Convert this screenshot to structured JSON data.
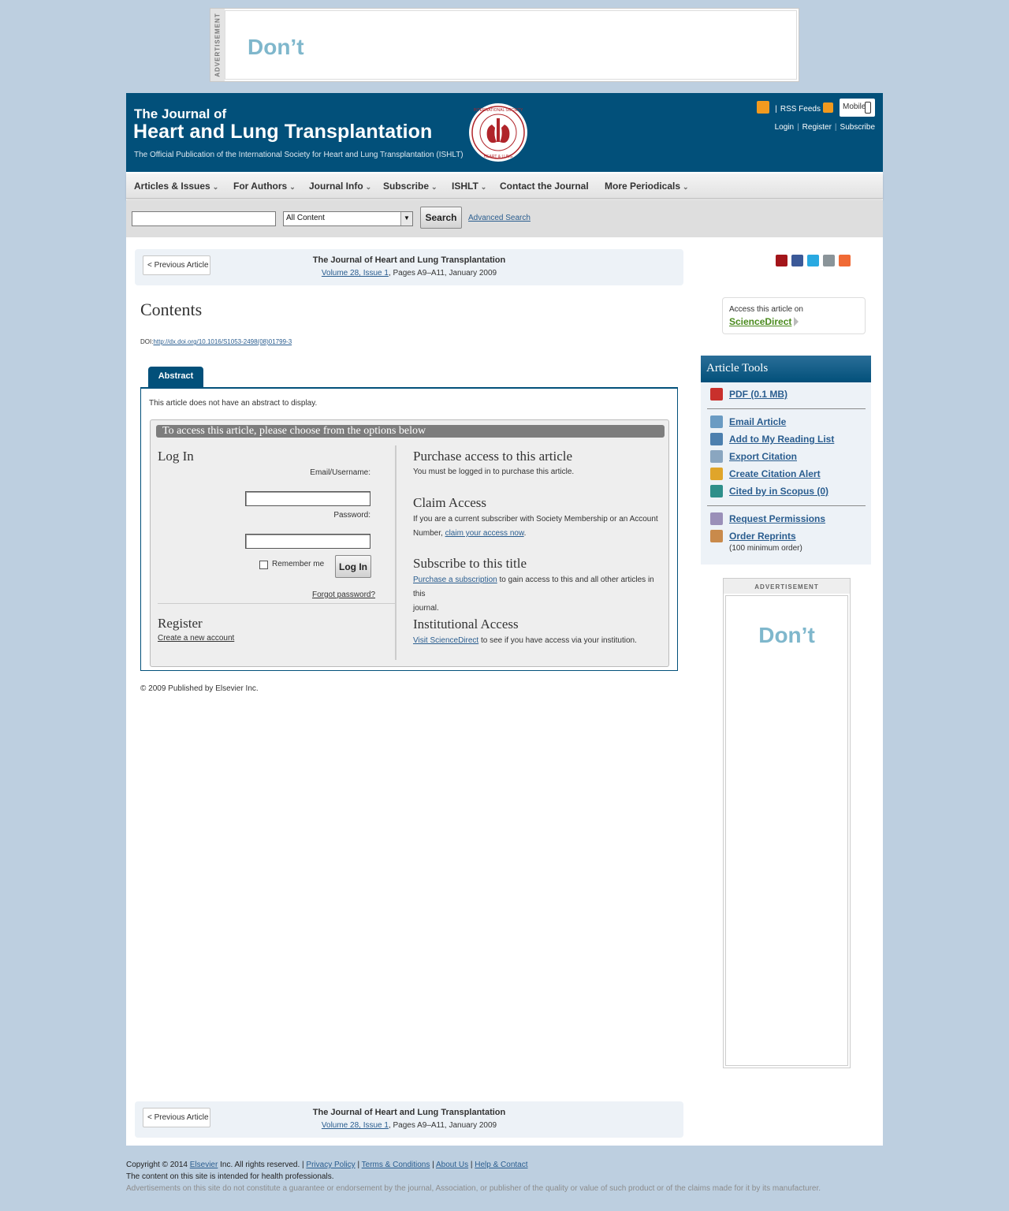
{
  "top_ad": {
    "label": "ADVERTISEMENT",
    "text": "Don’t"
  },
  "masthead": {
    "title_line1": "The Journal of",
    "title_line2": "Heart and Lung Transplantation",
    "subtitle": "The Official Publication of the International Society for Heart and Lung Transplantation (ISHLT)",
    "seal_label": "International Society for Heart & Lung Transplantation",
    "rss_feeds": "RSS Feeds",
    "mobile": "Mobile",
    "login": "Login",
    "register": "Register",
    "subscribe": "Subscribe"
  },
  "nav": {
    "articles_issues": "Articles & Issues",
    "for_authors": "For Authors",
    "journal_info": "Journal Info",
    "subscribe": "Subscribe",
    "ishlt": "ISHLT",
    "contact": "Contact the Journal",
    "more_periodicals": "More Periodicals"
  },
  "search": {
    "query": "",
    "scope": "All Content",
    "button": "Search",
    "advanced": "Advanced Search"
  },
  "article_nav": {
    "previous": "< Previous Article",
    "journal": "The Journal of Heart and Lung Transplantation",
    "volume_link": "Volume 28, Issue 1",
    "pages": ", Pages A9–A11, January 2009"
  },
  "article": {
    "title": "Contents",
    "doi_label": "DOI:",
    "doi_link": "http://dx.doi.org/10.1016/S1053-2498(08)01799-3",
    "tab_abstract": "Abstract",
    "no_abstract": "This article does not have an abstract to display.",
    "access_heading": "To access this article, please choose from the options below",
    "copyright": "© 2009 Published by Elsevier Inc."
  },
  "login": {
    "heading": "Log In",
    "email_label": "Email/Username:",
    "email_value": "",
    "password_label": "Password:",
    "password_value": "",
    "remember": "Remember me",
    "button": "Log In",
    "forgot": "Forgot password?",
    "register_heading": "Register",
    "create_account": "Create a new account"
  },
  "options": {
    "purchase_heading": "Purchase access to this article",
    "purchase_text": "You must be logged in to purchase this article.",
    "claim_heading": "Claim Access",
    "claim_text_line1": "If you are a current subscriber with Society Membership or an Account",
    "claim_text_prefix": "Number, ",
    "claim_link": "claim your access now",
    "claim_suffix": ".",
    "subscribe_heading": "Subscribe to this title",
    "subscribe_link": "Purchase a subscription",
    "subscribe_text": " to gain access to this and all other articles in this",
    "subscribe_text2": "journal.",
    "institutional_heading": "Institutional Access",
    "institutional_link": "Visit ScienceDirect",
    "institutional_text": " to see if you have access via your institution."
  },
  "sciencedirect": {
    "line1": "Access this article on",
    "link": "ScienceDirect"
  },
  "share_icons": [
    "mendeley-icon",
    "facebook-icon",
    "twitter-icon",
    "email-icon",
    "more-share-icon"
  ],
  "tools": {
    "heading": "Article Tools",
    "pdf": "PDF (0.1 MB)",
    "email": "Email Article",
    "reading_list": "Add to My Reading List",
    "export": "Export Citation",
    "alert": "Create Citation Alert",
    "scopus": "Cited by in Scopus (0)",
    "permissions": "Request Permissions",
    "reprints": "Order Reprints",
    "min_order": "(100 minimum order)"
  },
  "side_ad": {
    "label": "ADVERTISEMENT",
    "text": "Don’t"
  },
  "footer": {
    "copyright_prefix": "Copyright © 2014 ",
    "elsevier": "Elsevier",
    "rights": " Inc. All rights reserved. | ",
    "privacy": "Privacy Policy",
    "terms": "Terms & Conditions",
    "about": "About Us",
    "help": "Help & Contact",
    "sep": " | ",
    "health": "The content on this site is intended for health professionals.",
    "disclaimer": "Advertisements on this site do not constitute a guarantee or endorsement by the journal, Association, or publisher of the quality or value of such product or of the claims made for it by its manufacturer."
  },
  "colors": {
    "brand": "#02507a",
    "link": "#2a5d8f",
    "page_bg": "#bdcfe0",
    "sciencedirect": "#4a8a1d"
  }
}
